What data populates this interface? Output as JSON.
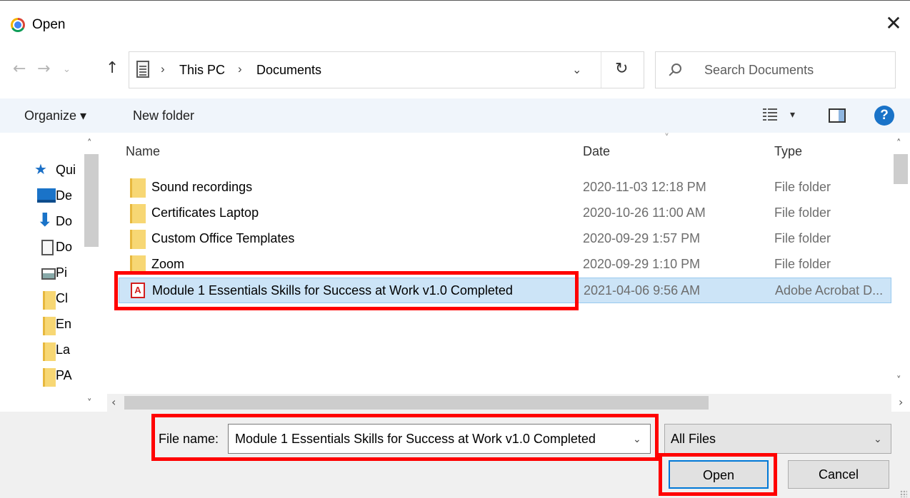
{
  "window": {
    "title": "Open",
    "close_glyph": "✕"
  },
  "nav": {
    "back": "←",
    "forward": "→",
    "recent": "⌄",
    "up": "↑"
  },
  "address": {
    "separator": "›",
    "crumbs": [
      "This PC",
      "Documents"
    ],
    "dropdown": "⌄",
    "refresh": "↻"
  },
  "search": {
    "placeholder": "Search Documents"
  },
  "toolbar": {
    "organize_label": "Organize ▾",
    "new_folder_label": "New folder",
    "view_dropdown": "▾",
    "help": "?"
  },
  "sidebar": {
    "items": [
      {
        "label": "Qui",
        "icon": "star-icon"
      },
      {
        "label": "De",
        "icon": "desktop-icon"
      },
      {
        "label": "Do",
        "icon": "downloads-icon"
      },
      {
        "label": "Do",
        "icon": "documents-icon"
      },
      {
        "label": "Pi",
        "icon": "pictures-icon"
      },
      {
        "label": "Cl",
        "icon": "folder-icon"
      },
      {
        "label": "En",
        "icon": "folder-icon"
      },
      {
        "label": "La",
        "icon": "folder-icon"
      },
      {
        "label": "PA",
        "icon": "folder-icon"
      }
    ],
    "scroll_up": "˄",
    "scroll_down": "˅"
  },
  "filelist": {
    "columns": {
      "name": "Name",
      "date": "Date",
      "type": "Type"
    },
    "sort_indicator": "˅",
    "rows": [
      {
        "name": "Sound recordings",
        "date": "2020-11-03 12:18 PM",
        "type": "File folder",
        "kind": "folder"
      },
      {
        "name": "Certificates Laptop",
        "date": "2020-10-26 11:00 AM",
        "type": "File folder",
        "kind": "folder"
      },
      {
        "name": "Custom Office Templates",
        "date": "2020-09-29 1:57 PM",
        "type": "File folder",
        "kind": "folder"
      },
      {
        "name": "Zoom",
        "date": "2020-09-29 1:10 PM",
        "type": "File folder",
        "kind": "folder"
      },
      {
        "name": "Module 1 Essentials Skills for Success at Work v1.0 Completed",
        "date": "2021-04-06 9:56 AM",
        "type": "Adobe Acrobat D...",
        "kind": "pdf",
        "selected": true
      }
    ],
    "pdf_glyph": "A",
    "scroll_up": "˄",
    "scroll_down": "˅",
    "scroll_left": "‹",
    "scroll_right": "›"
  },
  "footer": {
    "file_name_label": "File name:",
    "file_name_value": "Module 1 Essentials Skills for Success at Work v1.0 Completed",
    "file_name_dropdown": "⌄",
    "filter_value": "All Files",
    "filter_dropdown": "⌄",
    "open_label": "Open",
    "cancel_label": "Cancel"
  },
  "colors": {
    "highlight": "#ff0000",
    "selection": "#cce4f7",
    "accent": "#0078d7"
  }
}
